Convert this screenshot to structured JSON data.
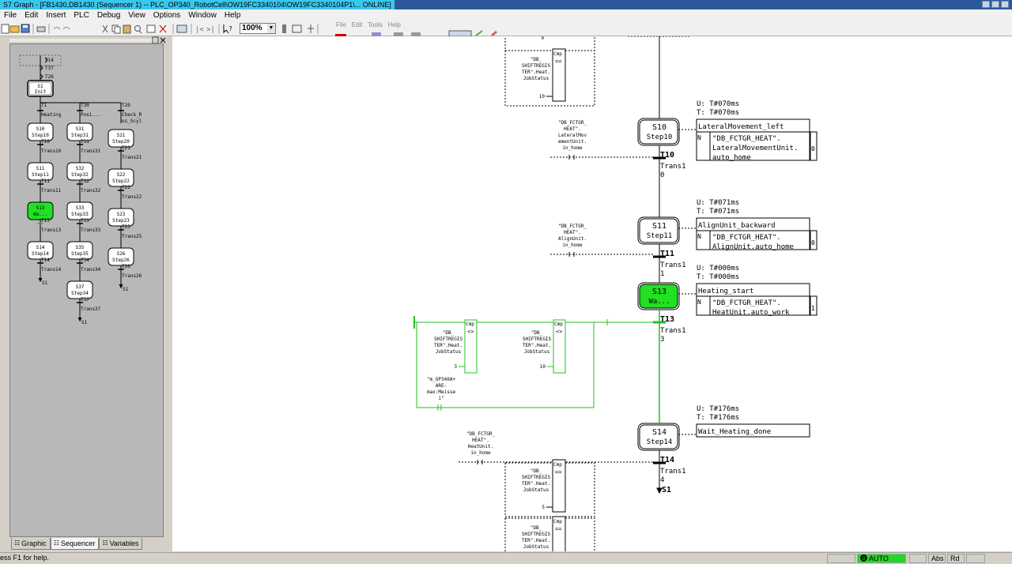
{
  "window": {
    "title": "S7 Graph - [FB1430,DB1430 (Sequencer 1) -- PLC_OP340_RobotCell\\OW19FC3340104\\OW19FC3340104P1\\... ONLINE]"
  },
  "menu": [
    "File",
    "Edit",
    "Insert",
    "PLC",
    "Debug",
    "View",
    "Options",
    "Window",
    "Help"
  ],
  "toolbar": {
    "zoom": "100%"
  },
  "tabs": [
    {
      "label": "Graphic",
      "icon": "graphic-tab-icon"
    },
    {
      "label": "Sequencer",
      "icon": "sequencer-tab-icon"
    },
    {
      "label": "Variables",
      "icon": "variables-tab-icon"
    }
  ],
  "overview": {
    "top_jumps": [
      "T14",
      "T37",
      "T26"
    ],
    "init_step": {
      "num": "S1",
      "name": "Init"
    },
    "branch1": {
      "t0": "T1",
      "t0_name": "Heating",
      "items": [
        {
          "type": "step",
          "num": "S10",
          "name": "Step10"
        },
        {
          "type": "trans",
          "num": "T10",
          "name": "Trans10"
        },
        {
          "type": "step",
          "num": "S11",
          "name": "Step11"
        },
        {
          "type": "trans",
          "num": "T11",
          "name": "Trans11"
        },
        {
          "type": "step",
          "num": "S13",
          "name": "Wa...",
          "active": true
        },
        {
          "type": "trans",
          "num": "T13",
          "name": "Trans13"
        },
        {
          "type": "step",
          "num": "S14",
          "name": "Step14"
        },
        {
          "type": "trans",
          "num": "T14",
          "name": "Trans14"
        }
      ],
      "jump": "S1"
    },
    "branch2": {
      "t0": "T30",
      "t0_name": "Posi...",
      "items": [
        {
          "type": "step",
          "num": "S31",
          "name": "Step31"
        },
        {
          "type": "trans",
          "num": "T31",
          "name": "Trans31"
        },
        {
          "type": "step",
          "num": "S32",
          "name": "Step32"
        },
        {
          "type": "trans",
          "num": "T32",
          "name": "Trans32"
        },
        {
          "type": "step",
          "num": "S33",
          "name": "Step33"
        },
        {
          "type": "trans",
          "num": "T33",
          "name": "Trans33"
        },
        {
          "type": "step",
          "num": "S35",
          "name": "Step35"
        },
        {
          "type": "trans",
          "num": "T34",
          "name": "Trans34"
        },
        {
          "type": "step",
          "num": "S37",
          "name": "Step34"
        },
        {
          "type": "trans",
          "num": "T37",
          "name": "Trans37"
        }
      ],
      "jump": "S1"
    },
    "branch3": {
      "t0": "T20",
      "t0_name": "Check_R\nos_Scyl",
      "items": [
        {
          "type": "step",
          "num": "S21",
          "name": "Step20"
        },
        {
          "type": "trans",
          "num": "T21",
          "name": "Trans21"
        },
        {
          "type": "step",
          "num": "S22",
          "name": "Step22"
        },
        {
          "type": "trans",
          "num": "T22",
          "name": "Trans22"
        },
        {
          "type": "step",
          "num": "S23",
          "name": "Step23"
        },
        {
          "type": "trans",
          "num": "T25",
          "name": "Trans25"
        },
        {
          "type": "step",
          "num": "S26",
          "name": "Step26"
        },
        {
          "type": "trans",
          "num": "T26",
          "name": "Trans26"
        }
      ],
      "jump": "S1"
    }
  },
  "sequence": {
    "steps": [
      {
        "num": "S10",
        "name": "Step10",
        "active": false,
        "u_time": "U: T#070ms",
        "t_time": "T: T#070ms",
        "action_title": "LateralMovement_left",
        "qualifier": "N",
        "action_lines": [
          "\"DB_FCTGR_HEAT\".",
          "LateralMovementUnit.",
          "auto_home"
        ],
        "action_value": "0",
        "trans_num": "T10",
        "trans_name": [
          "Trans1",
          "0"
        ],
        "cond_lines": [
          "\"DB_FCTGR_",
          "HEAT\".",
          "LateralMov",
          "ementUnit.",
          "in_home"
        ]
      },
      {
        "num": "S11",
        "name": "Step11",
        "active": false,
        "u_time": "U: T#071ms",
        "t_time": "T: T#071ms",
        "action_title": "AlignUnit_backward",
        "qualifier": "N",
        "action_lines": [
          "\"DB_FCTGR_HEAT\".",
          "AlignUnit.auto_home"
        ],
        "action_value": "0",
        "trans_num": "T11",
        "trans_name": [
          "Trans1",
          "1"
        ],
        "cond_lines": [
          "\"DB_FCTGR_",
          "HEAT\".",
          "AlignUnit.",
          "in_home"
        ]
      },
      {
        "num": "S13",
        "name": "Wa...",
        "active": true,
        "u_time": "U: T#000ms",
        "t_time": "T: T#000ms",
        "action_title": "Heating_start",
        "qualifier": "N",
        "action_lines": [
          "\"DB_FCTGR_HEAT\".",
          "HeatUnit.auto_work"
        ],
        "action_value": "1",
        "trans_num": "T13",
        "trans_name": [
          "Trans1",
          "3"
        ]
      },
      {
        "num": "S14",
        "name": "Step14",
        "active": false,
        "u_time": "U: T#176ms",
        "t_time": "T: T#176ms",
        "action_title": "Wait_Heating_done",
        "trans_num": "T14",
        "trans_name": [
          "Trans1",
          "4"
        ],
        "cond_lines": [
          "\"DB_FCTGR_",
          "HEAT\".",
          "HeatUnit.",
          "in_home"
        ]
      }
    ],
    "jump": "S1",
    "cmp_label": "Cmp",
    "cmp_eq": "==",
    "cmp_ne": "<>",
    "cmp_operand": [
      "\"DB_",
      "SHIFTREGIS",
      "TER\".Heat.",
      "JobStatus"
    ],
    "cmp_top": {
      "in2": "10",
      "top_value": "9"
    },
    "t13_cmp1": {
      "in2": "3"
    },
    "t13_cmp2": {
      "in2": "10"
    },
    "t13_contact": [
      "\"m_OP340A+",
      "ARE-",
      "max:Meisse",
      "i\""
    ],
    "t14_cmp1": {
      "in2": "5"
    }
  },
  "status": {
    "help": "ess F1 for help.",
    "mode": "AUTO",
    "abs": "Abs",
    "rd": "Rd"
  },
  "colors": {
    "active_step": "#22e022",
    "power_flow": "#22c022",
    "status_auto": "#22d822"
  }
}
